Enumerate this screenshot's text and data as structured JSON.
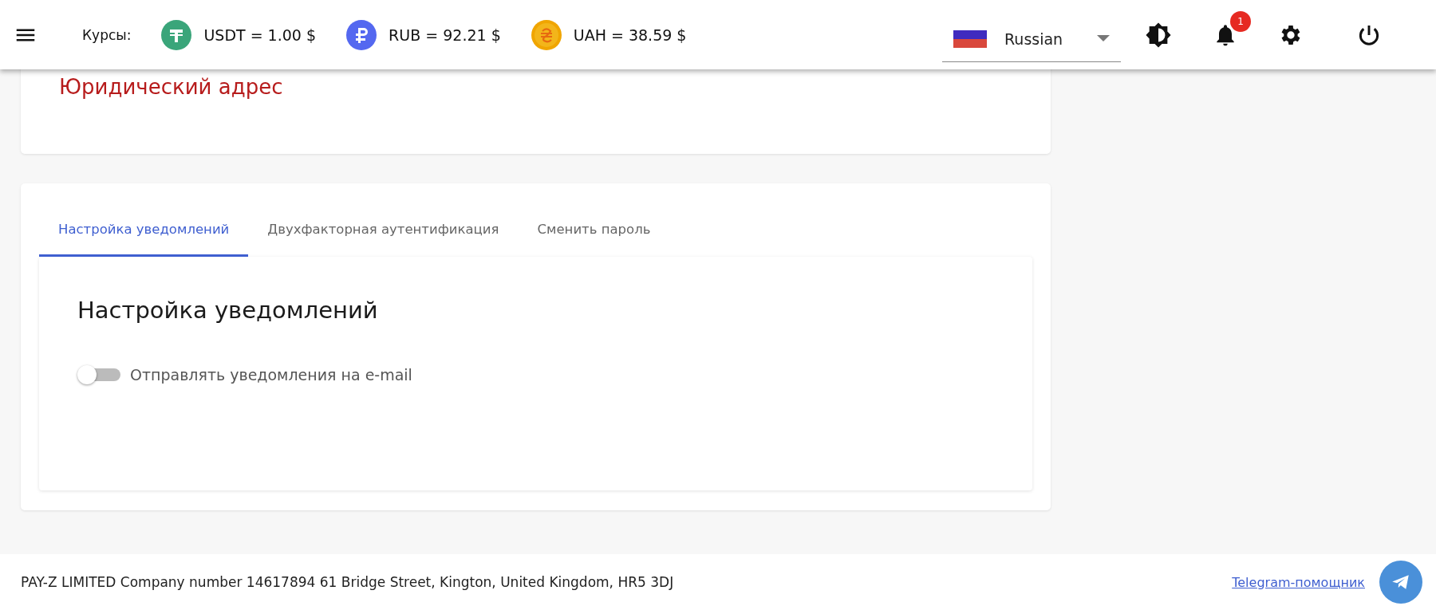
{
  "header": {
    "rates_label": "Курсы:",
    "rates": [
      {
        "kind": "usdt",
        "text": "USDT = 1.00 $"
      },
      {
        "kind": "rub",
        "text": "RUB = 92.21 $"
      },
      {
        "kind": "uah",
        "text": "UAH = 38.59 $"
      }
    ],
    "language": "Russian",
    "notifications_count": "1"
  },
  "legal_card": {
    "title": "Юридический адрес"
  },
  "settings": {
    "tabs": [
      {
        "label": "Настройка уведомлений",
        "selected": true
      },
      {
        "label": "Двухфакторная аутентификация",
        "selected": false
      },
      {
        "label": "Сменить пароль",
        "selected": false
      }
    ],
    "panel": {
      "title": "Настройка уведомлений",
      "toggles": [
        {
          "label": "Отправлять уведомления на e-mail",
          "on": false
        }
      ]
    }
  },
  "footer": {
    "text": "PAY-Z LIMITED Company number 14617894 61 Bridge Street, Kington, United Kingdom, HR5 3DJ",
    "link": "Telegram-помощник"
  }
}
